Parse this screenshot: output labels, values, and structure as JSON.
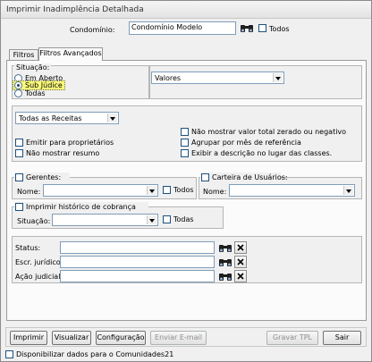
{
  "window": {
    "title": "Imprimir Inadimplência Detalhada"
  },
  "condominio": {
    "label": "Condomínio:",
    "value": "Condomínio Modelo",
    "todos_label": "Todos"
  },
  "tabs": [
    {
      "label": "Filtros"
    },
    {
      "label": "Filtros Avançados"
    }
  ],
  "situacao": {
    "title": "Situação:",
    "options": [
      {
        "label": "Em Aberto"
      },
      {
        "label": "Sub Júdice"
      },
      {
        "label": "Todas"
      }
    ],
    "selected": "Sub Júdice",
    "valores_value": "Valores"
  },
  "receitas": {
    "combo_value": "Todas as Receitas",
    "emitir_label": "Emitir para proprietários",
    "nao_resumo_label": "Não mostrar resumo",
    "nao_valor_zerado_label": "Não mostrar valor total zerado ou negativo",
    "agrupar_label": "Agrupar por mês de referência",
    "exibir_descricao_label": "Exibir a descrição no lugar das classes."
  },
  "gerentes": {
    "title": "Gerentes:",
    "nome_label": "Nome:",
    "todos_label": "Todos"
  },
  "carteira": {
    "title": "Carteira de Usuários:",
    "nome_label": "Nome:"
  },
  "historico": {
    "title": "Imprimir histórico de cobrança",
    "situacao_label": "Situação:",
    "todas_label": "Todas"
  },
  "status_fields": [
    {
      "label": "Status:"
    },
    {
      "label": "Escr. jurídico:"
    },
    {
      "label": "Ação judicial:"
    }
  ],
  "buttons": {
    "imprimir": "Imprimir",
    "visualizar": "Visualizar",
    "configuracao": "Configuração",
    "enviar_email": "Enviar E-mail",
    "gravar_tpl": "Gravar TPL",
    "sair": "Sair"
  },
  "footer": {
    "disponibilizar_label": "Disponibilizar dados para o Comunidades21"
  },
  "colors": {
    "highlight": "#fbfb7a",
    "accent_border": "#7f9db9"
  },
  "icons": {
    "search": "binoculars-icon",
    "clear": "close-x-icon"
  }
}
